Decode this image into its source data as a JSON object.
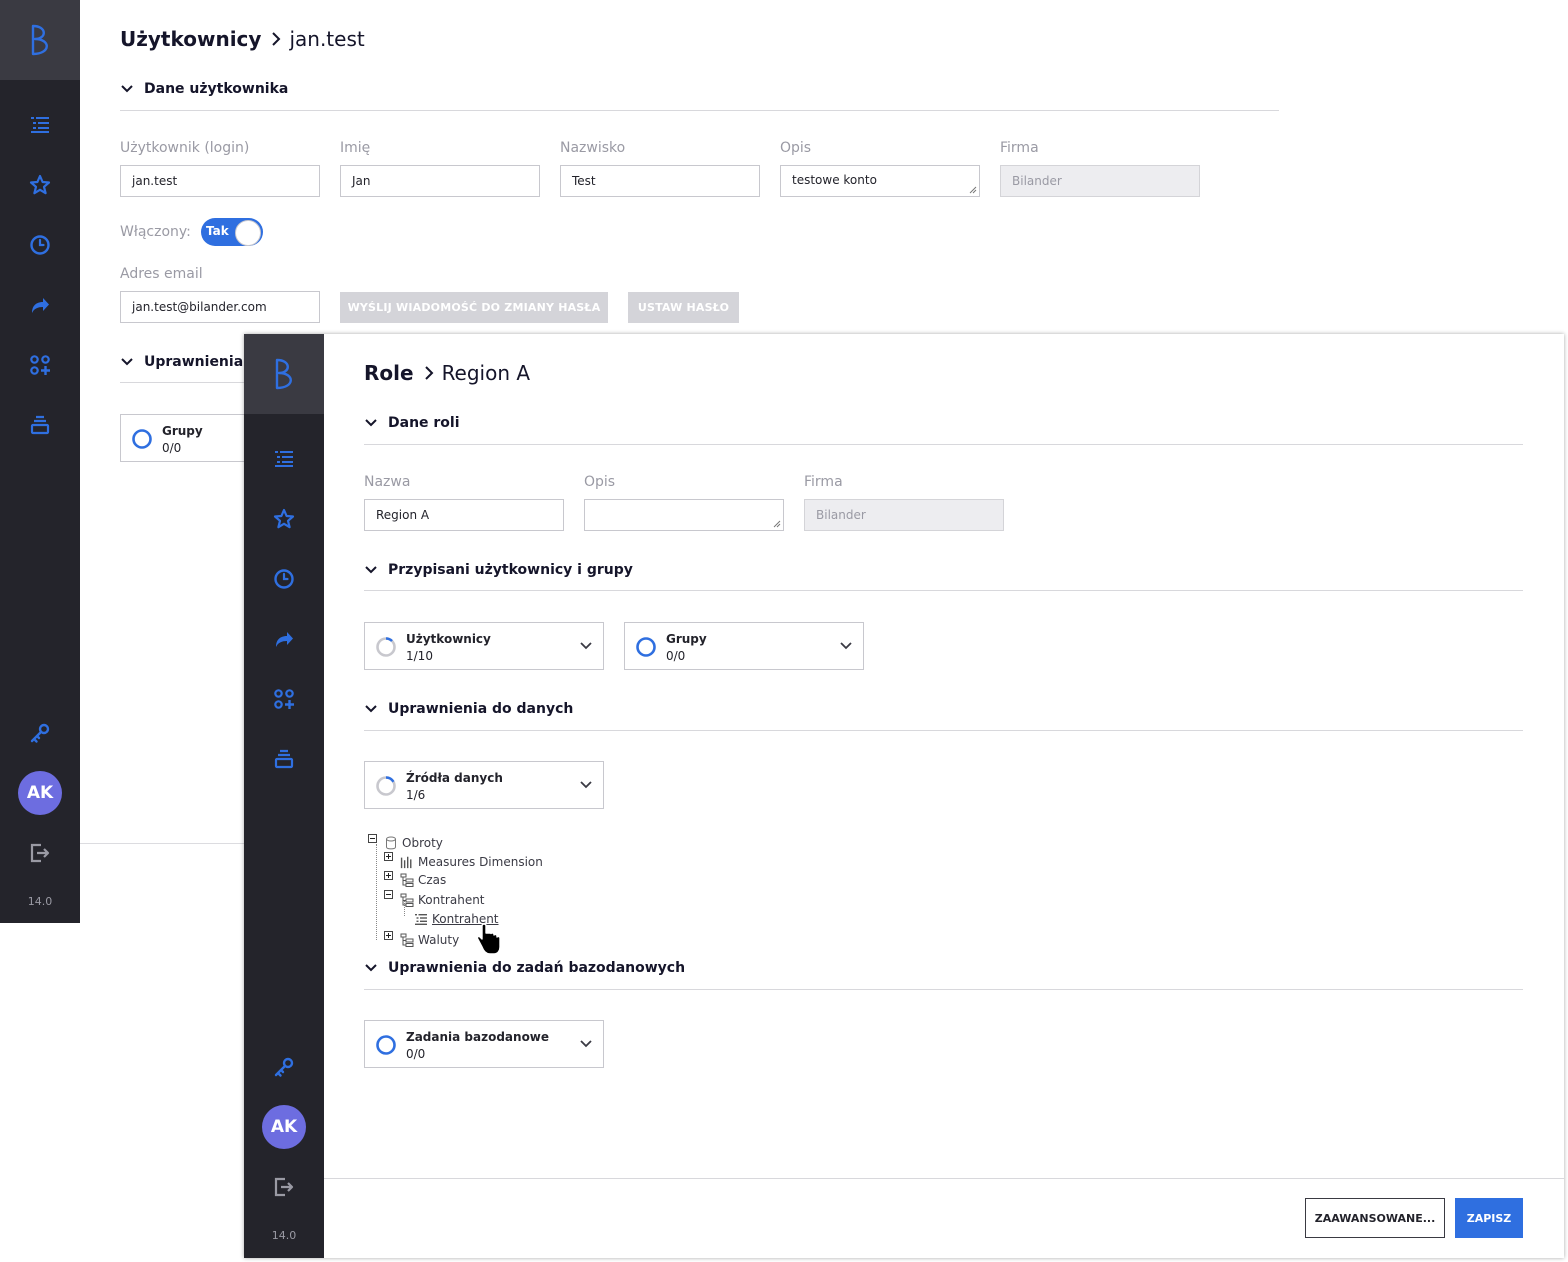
{
  "colors": {
    "accent": "#2f6fe0",
    "sidebar": "#24242b",
    "avatar": "#6d6de0"
  },
  "app": {
    "avatar_initials": "AK",
    "version": "14.0"
  },
  "sidebar_icons": [
    "list-icon",
    "star-icon",
    "clock-icon",
    "share-icon",
    "apps-add-icon",
    "stack-icon",
    "key-icon",
    "logout-icon"
  ],
  "user_page": {
    "breadcrumb": {
      "section": "Użytkownicy",
      "current": "jan.test"
    },
    "section_user_data": "Dane użytkownika",
    "fields": {
      "login": {
        "label": "Użytkownik (login)",
        "value": "jan.test"
      },
      "first_name": {
        "label": "Imię",
        "value": "Jan"
      },
      "last_name": {
        "label": "Nazwisko",
        "value": "Test"
      },
      "description": {
        "label": "Opis",
        "value": "testowe konto"
      },
      "company": {
        "label": "Firma",
        "value": "Bilander"
      }
    },
    "enabled": {
      "label": "Włączony:",
      "value": "Tak"
    },
    "email": {
      "label": "Adres email",
      "value": "jan.test@bilander.com"
    },
    "buttons": {
      "send_reset": "WYŚLIJ WIADOMOŚĆ DO ZMIANY HASŁA",
      "set_password": "USTAW HASŁO"
    },
    "section_permissions": "Uprawnienia",
    "groups_selector": {
      "title": "Grupy",
      "count": "0/0"
    }
  },
  "role_page": {
    "breadcrumb": {
      "section": "Role",
      "current": "Region A"
    },
    "section_role_data": "Dane roli",
    "fields": {
      "name": {
        "label": "Nazwa",
        "value": "Region A"
      },
      "description": {
        "label": "Opis",
        "value": ""
      },
      "company": {
        "label": "Firma",
        "value": "Bilander"
      }
    },
    "section_assigned": "Przypisani użytkownicy i grupy",
    "users_selector": {
      "title": "Użytkownicy",
      "count": "1/10"
    },
    "groups_selector": {
      "title": "Grupy",
      "count": "0/0"
    },
    "section_data_permissions": "Uprawnienia do danych",
    "sources_selector": {
      "title": "Źródła danych",
      "count": "1/6"
    },
    "tree": {
      "root": "Obroty",
      "children": [
        "Measures Dimension",
        "Czas",
        "Kontrahent",
        "Waluty"
      ],
      "kontrahent_child": "Kontrahent"
    },
    "section_db_tasks": "Uprawnienia do zadań bazodanowych",
    "tasks_selector": {
      "title": "Zadania bazodanowe",
      "count": "0/0"
    },
    "buttons": {
      "advanced": "ZAAWANSOWANE...",
      "save": "ZAPISZ"
    }
  }
}
